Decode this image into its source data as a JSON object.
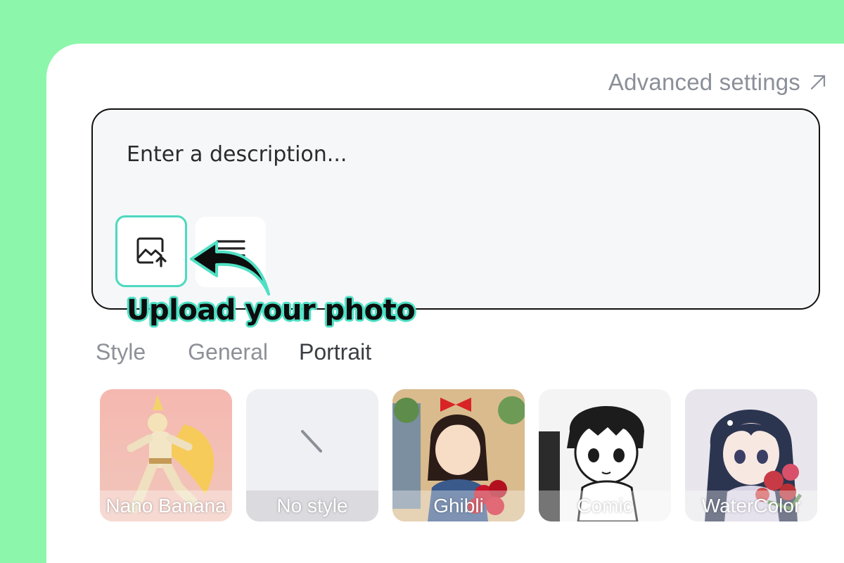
{
  "header": {
    "advanced_settings_label": "Advanced settings",
    "advanced_settings_icon": "arrow-up-right-icon"
  },
  "prompt": {
    "placeholder": "Enter a description...",
    "value": "",
    "upload_icon": "image-upload-icon",
    "text_icon": "text-lines-icon"
  },
  "annotation": {
    "caption": "Upload your photo",
    "arrow_icon": "curved-arrow-icon",
    "accent_color": "#4fe0c4"
  },
  "styles": {
    "section_label": "Style",
    "tabs": [
      {
        "label": "General",
        "active": false
      },
      {
        "label": "Portrait",
        "active": true
      }
    ],
    "cards": [
      {
        "label": "Nano Banana"
      },
      {
        "label": "No style"
      },
      {
        "label": "Ghibli"
      },
      {
        "label": "Comic"
      },
      {
        "label": "WaterColor"
      }
    ]
  },
  "colors": {
    "page_background": "#8cf7ab",
    "panel_background": "#ffffff",
    "highlight": "#4fd8c0"
  }
}
